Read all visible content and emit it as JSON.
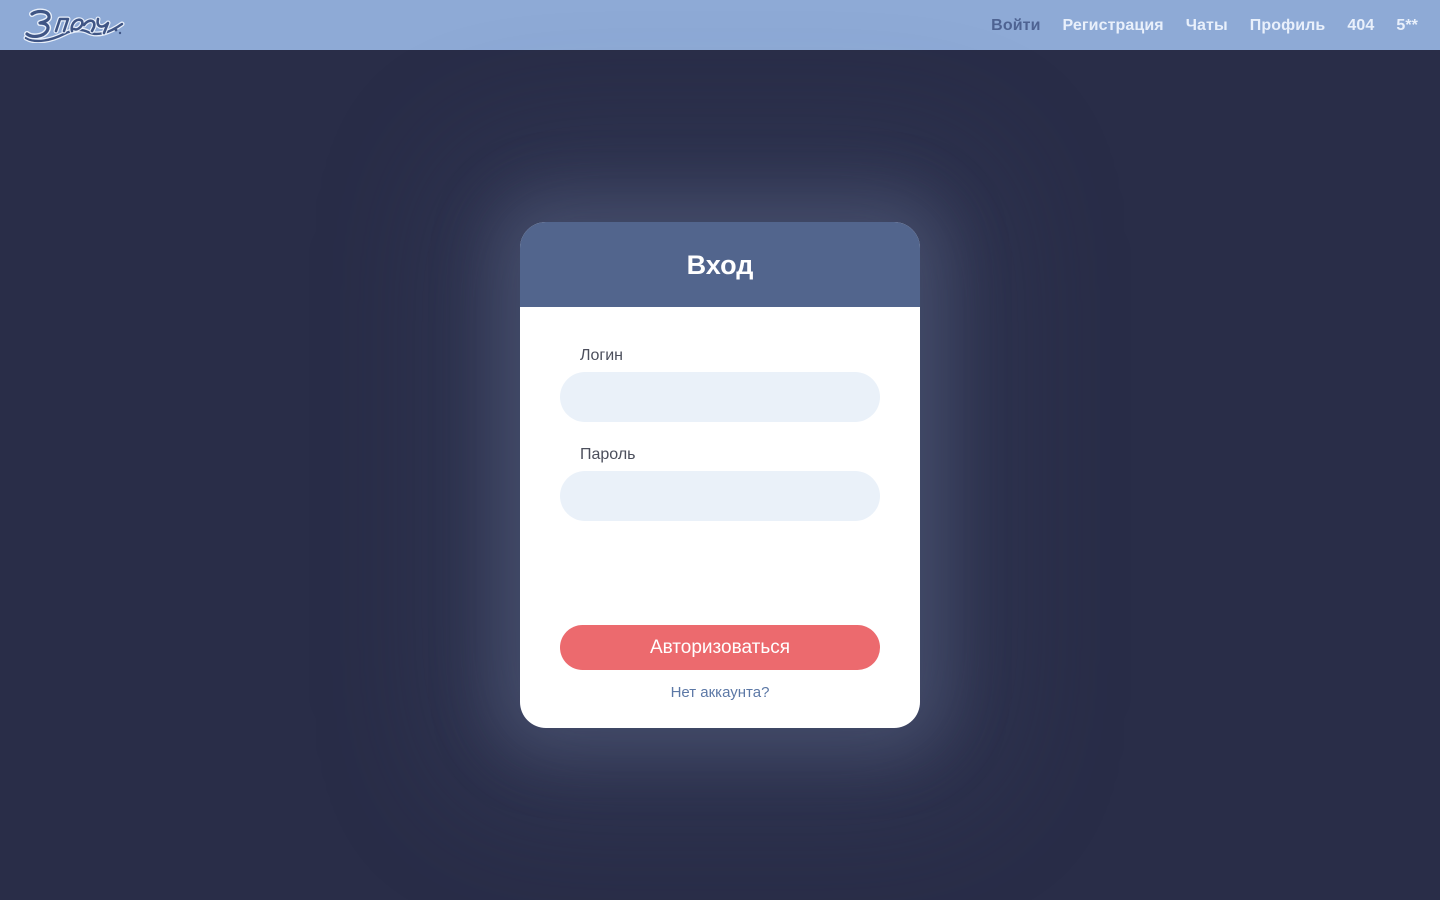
{
  "header": {
    "logo_icon": "brand-logo",
    "nav": [
      {
        "label": "Войти",
        "active": true
      },
      {
        "label": "Регистрация",
        "active": false
      },
      {
        "label": "Чаты",
        "active": false
      },
      {
        "label": "Профиль",
        "active": false
      },
      {
        "label": "404",
        "active": false
      },
      {
        "label": "5**",
        "active": false
      }
    ]
  },
  "login_card": {
    "title": "Вход",
    "fields": {
      "login": {
        "label": "Логин",
        "value": ""
      },
      "password": {
        "label": "Пароль",
        "value": ""
      }
    },
    "submit_label": "Авторизоваться",
    "register_link": "Нет аккаунта?"
  },
  "colors": {
    "page_background": "#292d48",
    "topbar": "#8eaad6",
    "nav_active": "#4e6392",
    "nav_inactive": "#e9f0fb",
    "card_header": "#52658d",
    "input_background": "#eaf1f9",
    "submit_button": "#ec6a6e",
    "link": "#5c78a6"
  }
}
